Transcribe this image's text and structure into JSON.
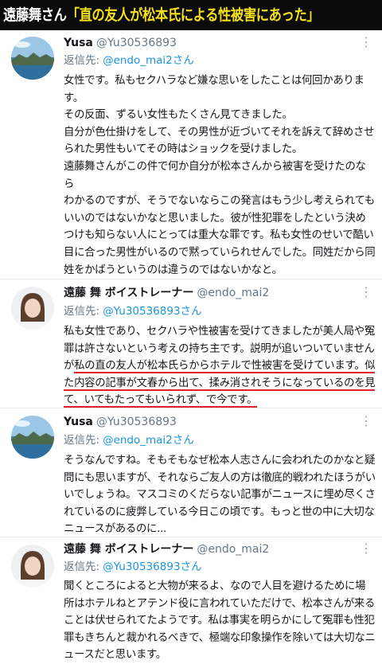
{
  "banner": {
    "name": "遠藤舞さん",
    "quote": "「直の友人が松本氏による性被害にあった」"
  },
  "colors": {
    "accent": "#1b95e0",
    "highlight": "#e0202a",
    "banner_text": "#f5e11a"
  },
  "tweets": [
    {
      "author": "Yusa",
      "handle": "@Yu30536893",
      "reply_label": "返信先:",
      "reply_to": "@endo_mai2さん",
      "lines": [
        "女性です。私もセクハラなど嫌な思いをしたことは何回かあります。",
        "その反面、ずるい女性もたくさん見てきました。",
        "自分が色仕掛けをして、その男性が近づいてそれを訴えて辞めさせられた男性もいてその時はショックを受けました。",
        "遠藤舞さんがこの件で何か自分が松本さんから被害を受けたのなら",
        "わかるのですが、そうでないならこの発言はもう少し考えられてもいいのではないかなと思いました。彼が性犯罪をしたという決めつけも知らない人にとっては重大な罪です。私も女性のせいで酷い目に合った男性がいるので黙っていられせんでした。同姓だから同姓をかばうというのは違うのではないかなと。"
      ]
    },
    {
      "author": "遠藤 舞 ボイストレーナー",
      "handle": "@endo_mai2",
      "reply_label": "返信先:",
      "reply_to": "@Yu30536893さん",
      "text_plain": "私も女性であり、セクハラや性被害を受けてきましたが美人局や冤罪は許さないという考えの持ち主です。説明が追いついていませんが",
      "text_underlined": "私の直の友人が松本氏らからホテルで性被害を受けています。似た内容の記事が文春から出て、揉み消されそうになっているのを見て、いてもたってもいられず、で今です。"
    },
    {
      "author": "Yusa",
      "handle": "@Yu30536893",
      "reply_label": "返信先:",
      "reply_to": "@endo_mai2さん",
      "text": "そうなんですね。そもそもなぜ松本人志さんに会われたのかなと疑問にも思いますが、それならご友人の方は徹底的戦われたほうがいいでしょうね。マスコミのくだらない記事がニュースに埋め尽くされているのに疲弊している今日この頃です。もっと世の中に大切なニュースがあるのに..."
    },
    {
      "author": "遠藤 舞 ボイストレーナー",
      "handle": "@endo_mai2",
      "reply_label": "返信先:",
      "reply_to": "@Yu30536893さん",
      "text": "聞くところによると大物が来るよ、なので人目を避けるために場所はホテルねとアテンド役に言われていただけで、松本さんが来ることは伏せられてたようです。私は事実を明らかにして冤罪も性犯罪もきちんと裁かれるべきで、極端な印象操作を除いては大切なニュースだと思います。"
    }
  ]
}
